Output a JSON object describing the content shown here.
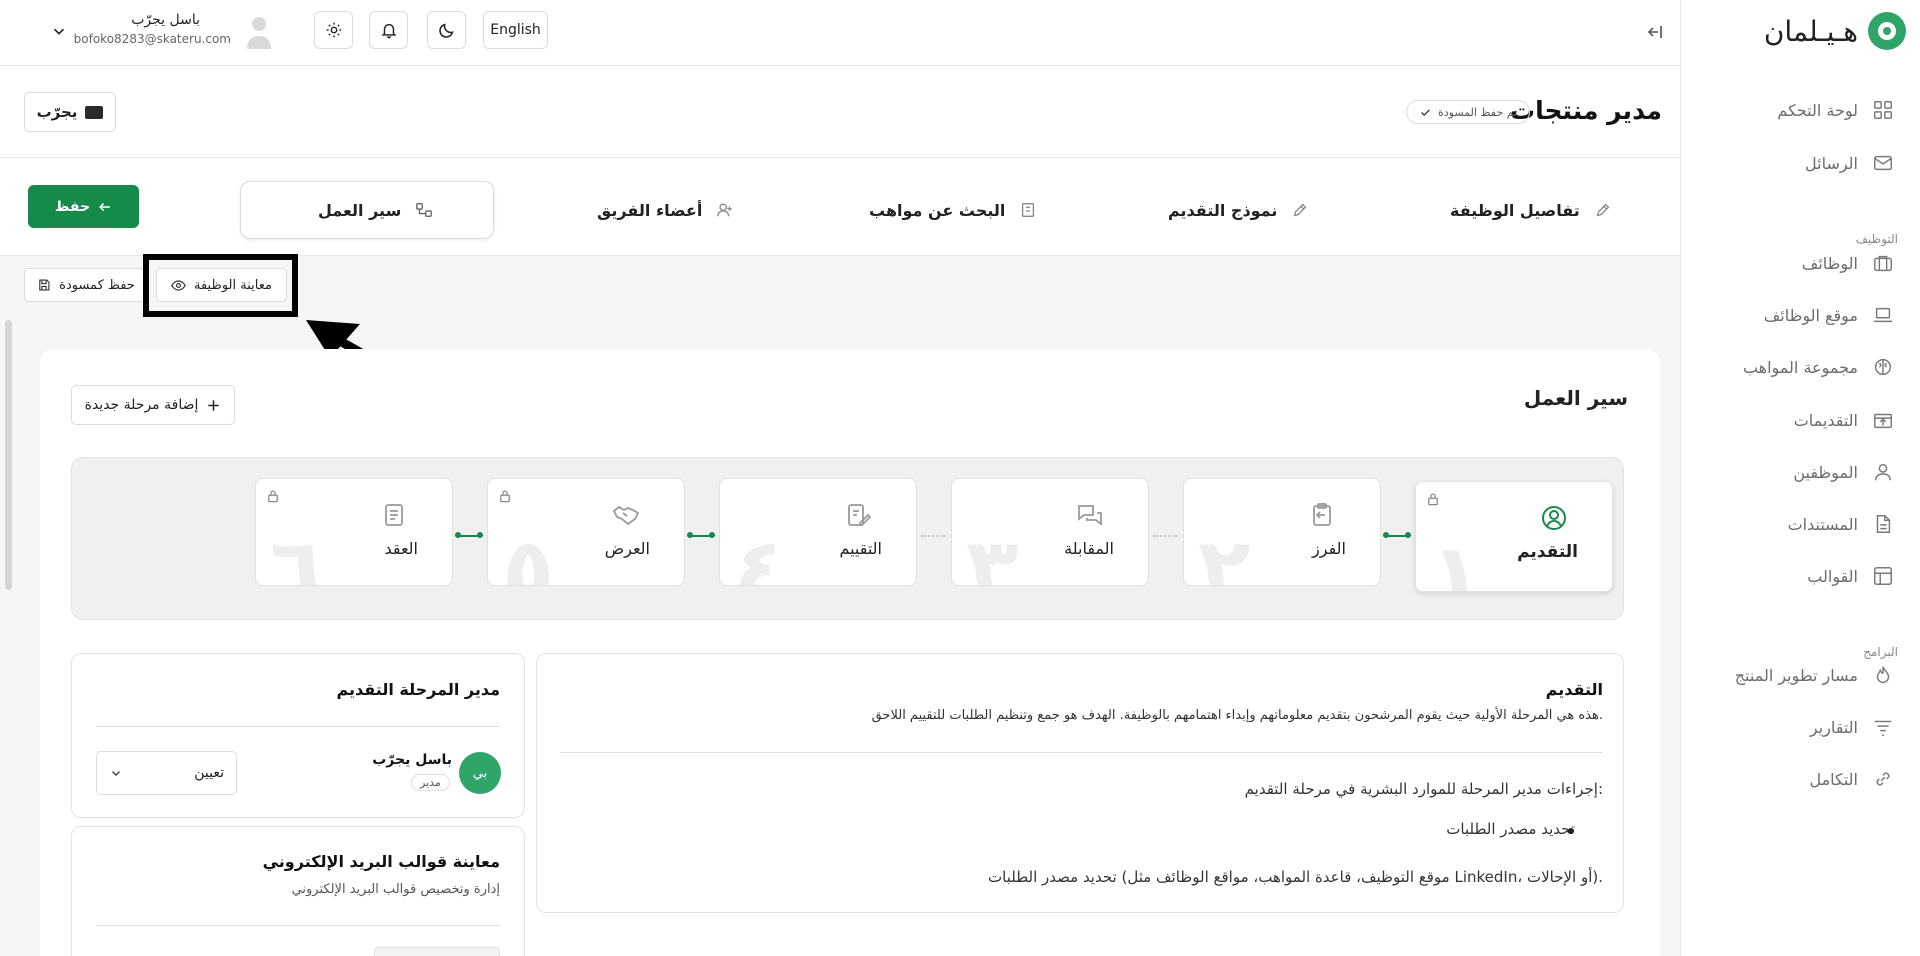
{
  "brand": {
    "name": "هـيـلمان"
  },
  "sidebar": {
    "items": [
      {
        "label": "لوحة التحكم",
        "icon": "grid-icon"
      },
      {
        "label": "الرسائل",
        "icon": "mail-icon"
      },
      {
        "label": "الوظائف",
        "icon": "briefcase-icon"
      },
      {
        "label": "موقع الوظائف",
        "icon": "laptop-icon"
      },
      {
        "label": "مجموعة المواهب",
        "icon": "brain-icon"
      },
      {
        "label": "التقديمات",
        "icon": "upload-box-icon"
      },
      {
        "label": "الموظفين",
        "icon": "user-icon"
      },
      {
        "label": "المستندات",
        "icon": "document-icon"
      },
      {
        "label": "القوالب",
        "icon": "template-icon"
      },
      {
        "label": "مسار تطوير المنتج",
        "icon": "flame-icon"
      },
      {
        "label": "التقارير",
        "icon": "filter-icon"
      },
      {
        "label": "التكامل",
        "icon": "link-icon"
      }
    ],
    "sections": {
      "hiring": "التوظيف",
      "programs": "البرامج"
    }
  },
  "topbar": {
    "language": "English",
    "user_name": "باسل يجرّب",
    "user_email": "bofoko8283@skateru.com"
  },
  "header": {
    "title": "مدير منتجات",
    "draft_status": "تم حفظ المسودة",
    "preview_button": "يجرّب"
  },
  "tabs": [
    {
      "label": "تفاصيل الوظيفة"
    },
    {
      "label": "نموذج التقديم"
    },
    {
      "label": "البحث عن مواهب"
    },
    {
      "label": "أعضاء الفريق"
    },
    {
      "label": "سير العمل"
    }
  ],
  "actions": {
    "save": "حفظ",
    "save_draft": "حفظ كمسودة",
    "preview_job": "معاينة الوظيفة",
    "add_stage": "إضافة مرحلة جديدة"
  },
  "workflow": {
    "title": "سير العمل",
    "stages": [
      {
        "num": "١",
        "label": "التقديم",
        "active": true
      },
      {
        "num": "٢",
        "label": "الفرز"
      },
      {
        "num": "٣",
        "label": "المقابلة"
      },
      {
        "num": "٤",
        "label": "التقييم"
      },
      {
        "num": "٥",
        "label": "العرض",
        "locked": true
      },
      {
        "num": "٦",
        "label": "العقد",
        "locked": true
      }
    ]
  },
  "detail": {
    "title": "التقديم",
    "description": "هذه هي المرحلة الأولية حيث يقوم المرشحون بتقديم معلوماتهم وإبداء اهتمامهم بالوظيفة. الهدف هو جمع وتنظيم الطلبات للتقييم اللاحق.",
    "actions_heading": "إجراءات مدير المرحلة للموارد البشرية في مرحلة التقديم:",
    "bullet": "تحديد مصدر الطلبات",
    "bullet_detail": "تحديد مصدر الطلبات (موقع التوظيف، قاعدة المواهب، مواقع الوظائف مثل LinkedIn، أو الإحالات)."
  },
  "manager": {
    "title": "مدير المرحلة التقديم",
    "name": "باسل يجرّب",
    "initials": "بي",
    "role": "مدير",
    "assign": "تعيين"
  },
  "email_templates": {
    "title": "معاينة قوالب البريد الإلكتروني",
    "subtitle": "إدارة وتخصيص قوالب البريد الإلكتروني"
  },
  "colors": {
    "primary": "#168a4a",
    "accent": "#2fa56a"
  }
}
